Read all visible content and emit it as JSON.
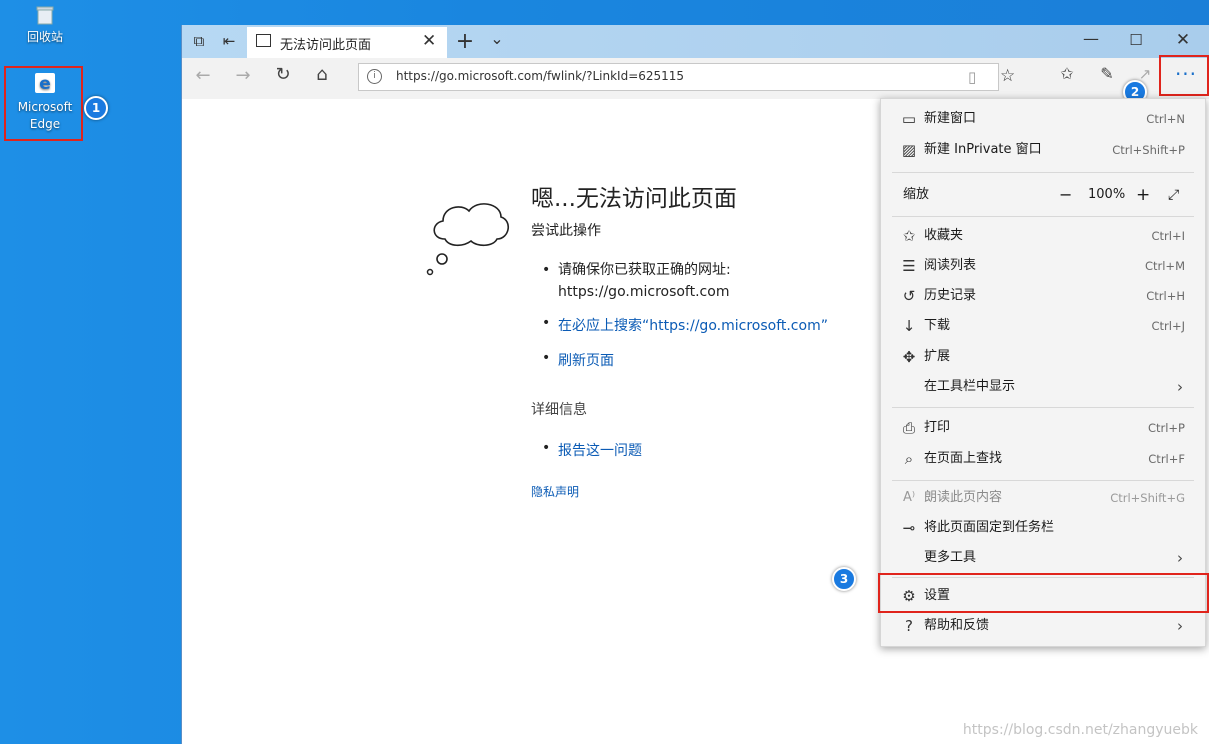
{
  "desktop": {
    "recycle_bin_label": "回收站",
    "edge_label_line1": "Microsoft",
    "edge_label_line2": "Edge"
  },
  "badges": {
    "one": "1",
    "two": "2",
    "three": "3"
  },
  "tab": {
    "title": "无法访问此页面"
  },
  "address": {
    "url": "https://go.microsoft.com/fwlink/?LinkId=625115"
  },
  "page": {
    "heading": "嗯...无法访问此页面",
    "try_label": "尝试此操作",
    "bullet1_line1": "请确保你已获取正确的网址:",
    "bullet1_line2": "https://go.microsoft.com",
    "bullet2": "在必应上搜索“https://go.microsoft.com”",
    "bullet3": "刷新页面",
    "details_label": "详细信息",
    "bullet4": "报告这一问题",
    "privacy": "隐私声明"
  },
  "menu": {
    "new_window": {
      "label": "新建窗口",
      "shortcut": "Ctrl+N"
    },
    "new_inprivate": {
      "label": "新建 InPrivate 窗口",
      "shortcut": "Ctrl+Shift+P"
    },
    "zoom": {
      "label": "缩放",
      "value": "100%"
    },
    "favorites": {
      "label": "收藏夹",
      "shortcut": "Ctrl+I"
    },
    "reading_list": {
      "label": "阅读列表",
      "shortcut": "Ctrl+M"
    },
    "history": {
      "label": "历史记录",
      "shortcut": "Ctrl+H"
    },
    "downloads": {
      "label": "下载",
      "shortcut": "Ctrl+J"
    },
    "extensions": {
      "label": "扩展"
    },
    "show_in_toolbar": {
      "label": "在工具栏中显示"
    },
    "print": {
      "label": "打印",
      "shortcut": "Ctrl+P"
    },
    "find": {
      "label": "在页面上查找",
      "shortcut": "Ctrl+F"
    },
    "read_aloud": {
      "label": "朗读此页内容",
      "shortcut": "Ctrl+Shift+G"
    },
    "pin": {
      "label": "将此页面固定到任务栏"
    },
    "more_tools": {
      "label": "更多工具"
    },
    "settings": {
      "label": "设置"
    },
    "help": {
      "label": "帮助和反馈"
    }
  },
  "watermark": "https://blog.csdn.net/zhangyuebk",
  "colors": {
    "highlight": "#e0241c",
    "badge": "#1a7ae0",
    "link": "#0b5bb5"
  }
}
